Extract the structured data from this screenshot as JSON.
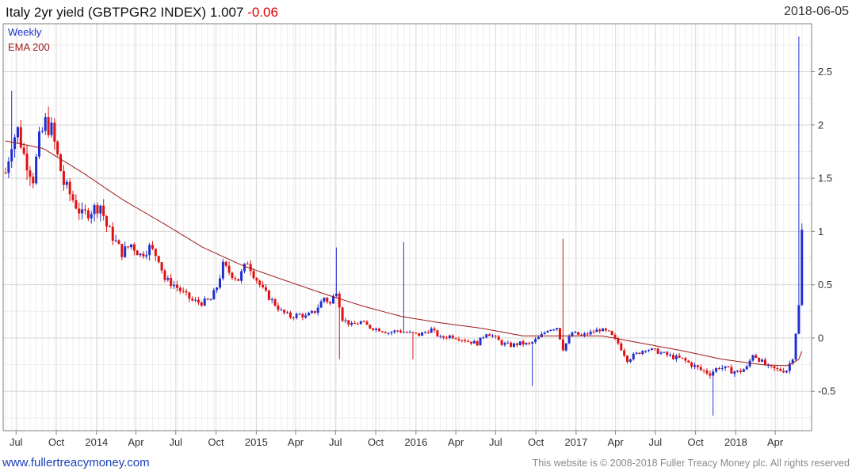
{
  "header": {
    "title": "Italy 2yr yield (GBTPGR2 INDEX) 1.007",
    "change": "-0.06",
    "date": "2018-06-05"
  },
  "legend": {
    "weekly": "Weekly",
    "ema": "EMA 200"
  },
  "footer": {
    "site": "www.fullertreacymoney.com",
    "copyright": "This website is © 2008-2018 Fuller Treacy Money plc. All rights reserved"
  },
  "colors": {
    "up": "#1f2fd0",
    "down": "#e01010",
    "ema": "#a01818",
    "grid": "#d9d9d9",
    "frame": "#7f7f7f"
  },
  "chart_data": {
    "type": "candlestick",
    "frequency": "weekly",
    "x_start": "2013-06-07",
    "x_end": "2018-06-05",
    "ylim": [
      -0.87,
      2.95
    ],
    "y_ticks": [
      -0.5,
      0,
      0.5,
      1,
      1.5,
      2,
      2.5
    ],
    "y_tick_labels": [
      "-0.5",
      "0",
      "0.5",
      "1",
      "1.5",
      "2",
      "2.5"
    ],
    "x_ticks": [
      {
        "date": "2013-07-01",
        "label": "Jul"
      },
      {
        "date": "2013-10-01",
        "label": "Oct"
      },
      {
        "date": "2014-01-01",
        "label": "2014"
      },
      {
        "date": "2014-04-01",
        "label": "Apr"
      },
      {
        "date": "2014-07-01",
        "label": "Jul"
      },
      {
        "date": "2014-10-01",
        "label": "Oct"
      },
      {
        "date": "2015-01-01",
        "label": "2015"
      },
      {
        "date": "2015-04-01",
        "label": "Apr"
      },
      {
        "date": "2015-07-01",
        "label": "Jul"
      },
      {
        "date": "2015-10-01",
        "label": "Oct"
      },
      {
        "date": "2016-01-01",
        "label": "2016"
      },
      {
        "date": "2016-04-01",
        "label": "Apr"
      },
      {
        "date": "2016-07-01",
        "label": "Jul"
      },
      {
        "date": "2016-10-01",
        "label": "Oct"
      },
      {
        "date": "2017-01-01",
        "label": "2017"
      },
      {
        "date": "2017-04-01",
        "label": "Apr"
      },
      {
        "date": "2017-07-01",
        "label": "Jul"
      },
      {
        "date": "2017-10-01",
        "label": "Oct"
      },
      {
        "date": "2018-01-01",
        "label": "2018"
      },
      {
        "date": "2018-04-01",
        "label": "Apr"
      }
    ],
    "price_anchors": [
      [
        "2013-06-07",
        1.55
      ],
      [
        "2013-06-21",
        1.85
      ],
      [
        "2013-07-05",
        1.95
      ],
      [
        "2013-07-19",
        1.72
      ],
      [
        "2013-08-09",
        1.5
      ],
      [
        "2013-08-23",
        1.85
      ],
      [
        "2013-09-06",
        2.02
      ],
      [
        "2013-09-20",
        1.95
      ],
      [
        "2013-10-04",
        1.7
      ],
      [
        "2013-10-18",
        1.45
      ],
      [
        "2013-11-08",
        1.3
      ],
      [
        "2013-11-29",
        1.15
      ],
      [
        "2013-12-20",
        1.2
      ],
      [
        "2014-01-10",
        1.25
      ],
      [
        "2014-01-24",
        1.05
      ],
      [
        "2014-02-07",
        0.95
      ],
      [
        "2014-02-28",
        0.8
      ],
      [
        "2014-03-21",
        0.88
      ],
      [
        "2014-04-11",
        0.78
      ],
      [
        "2014-05-02",
        0.85
      ],
      [
        "2014-05-23",
        0.75
      ],
      [
        "2014-06-06",
        0.55
      ],
      [
        "2014-06-27",
        0.5
      ],
      [
        "2014-07-18",
        0.42
      ],
      [
        "2014-08-08",
        0.35
      ],
      [
        "2014-08-29",
        0.33
      ],
      [
        "2014-09-19",
        0.36
      ],
      [
        "2014-10-03",
        0.48
      ],
      [
        "2014-10-17",
        0.68
      ],
      [
        "2014-10-31",
        0.62
      ],
      [
        "2014-11-21",
        0.55
      ],
      [
        "2014-12-12",
        0.72
      ],
      [
        "2014-12-26",
        0.6
      ],
      [
        "2015-01-16",
        0.45
      ],
      [
        "2015-02-06",
        0.35
      ],
      [
        "2015-02-27",
        0.25
      ],
      [
        "2015-03-20",
        0.2
      ],
      [
        "2015-04-10",
        0.22
      ],
      [
        "2015-04-24",
        0.2
      ],
      [
        "2015-05-15",
        0.25
      ],
      [
        "2015-06-05",
        0.38
      ],
      [
        "2015-06-19",
        0.32
      ],
      [
        "2015-07-03",
        0.45
      ],
      [
        "2015-07-17",
        0.18
      ],
      [
        "2015-08-07",
        0.12
      ],
      [
        "2015-08-28",
        0.15
      ],
      [
        "2015-09-18",
        0.1
      ],
      [
        "2015-10-09",
        0.08
      ],
      [
        "2015-10-30",
        0.05
      ],
      [
        "2015-11-20",
        0.07
      ],
      [
        "2015-12-11",
        0.05
      ],
      [
        "2016-01-08",
        0.03
      ],
      [
        "2016-02-05",
        0.08
      ],
      [
        "2016-02-26",
        0.0
      ],
      [
        "2016-03-18",
        0.02
      ],
      [
        "2016-04-08",
        0.0
      ],
      [
        "2016-04-29",
        -0.03
      ],
      [
        "2016-05-20",
        -0.05
      ],
      [
        "2016-06-10",
        0.05
      ],
      [
        "2016-06-24",
        0.02
      ],
      [
        "2016-07-15",
        -0.05
      ],
      [
        "2016-08-05",
        -0.07
      ],
      [
        "2016-08-26",
        -0.05
      ],
      [
        "2016-09-16",
        -0.06
      ],
      [
        "2016-10-07",
        0.0
      ],
      [
        "2016-10-28",
        0.08
      ],
      [
        "2016-11-18",
        0.1
      ],
      [
        "2016-12-02",
        -0.1
      ],
      [
        "2016-12-23",
        0.05
      ],
      [
        "2017-01-13",
        0.02
      ],
      [
        "2017-02-03",
        0.05
      ],
      [
        "2017-02-24",
        0.08
      ],
      [
        "2017-03-17",
        0.05
      ],
      [
        "2017-04-07",
        -0.05
      ],
      [
        "2017-04-28",
        -0.2
      ],
      [
        "2017-05-19",
        -0.15
      ],
      [
        "2017-06-09",
        -0.1
      ],
      [
        "2017-06-30",
        -0.12
      ],
      [
        "2017-07-21",
        -0.15
      ],
      [
        "2017-08-11",
        -0.18
      ],
      [
        "2017-09-01",
        -0.2
      ],
      [
        "2017-09-22",
        -0.25
      ],
      [
        "2017-10-13",
        -0.3
      ],
      [
        "2017-11-03",
        -0.33
      ],
      [
        "2017-11-24",
        -0.27
      ],
      [
        "2017-12-15",
        -0.3
      ],
      [
        "2018-01-05",
        -0.32
      ],
      [
        "2018-01-26",
        -0.28
      ],
      [
        "2018-02-09",
        -0.15
      ],
      [
        "2018-02-23",
        -0.2
      ],
      [
        "2018-03-16",
        -0.28
      ],
      [
        "2018-04-06",
        -0.3
      ],
      [
        "2018-04-27",
        -0.3
      ],
      [
        "2018-05-11",
        -0.18
      ],
      [
        "2018-05-18",
        0.05
      ],
      [
        "2018-05-25",
        0.3
      ],
      [
        "2018-06-01",
        1.0
      ],
      [
        "2018-06-05",
        1.007
      ]
    ],
    "wick_spikes": [
      [
        "2013-06-21",
        2.32
      ],
      [
        "2015-07-03",
        0.85
      ],
      [
        "2015-07-10",
        -0.2
      ],
      [
        "2015-12-04",
        0.9
      ],
      [
        "2015-12-25",
        -0.2
      ],
      [
        "2016-09-23",
        -0.45
      ],
      [
        "2016-12-02",
        0.93
      ],
      [
        "2017-11-10",
        -0.73
      ],
      [
        "2018-05-25",
        2.83
      ]
    ],
    "ema_anchors": [
      [
        "2013-06-07",
        1.85
      ],
      [
        "2013-09-01",
        1.78
      ],
      [
        "2013-12-01",
        1.55
      ],
      [
        "2014-03-01",
        1.3
      ],
      [
        "2014-06-01",
        1.08
      ],
      [
        "2014-09-01",
        0.85
      ],
      [
        "2014-12-01",
        0.68
      ],
      [
        "2015-03-01",
        0.55
      ],
      [
        "2015-06-01",
        0.42
      ],
      [
        "2015-09-01",
        0.3
      ],
      [
        "2015-12-01",
        0.2
      ],
      [
        "2016-03-01",
        0.14
      ],
      [
        "2016-06-01",
        0.09
      ],
      [
        "2016-09-01",
        0.02
      ],
      [
        "2016-12-01",
        0.02
      ],
      [
        "2017-03-01",
        0.02
      ],
      [
        "2017-06-01",
        -0.05
      ],
      [
        "2017-09-01",
        -0.12
      ],
      [
        "2017-12-01",
        -0.2
      ],
      [
        "2018-03-01",
        -0.25
      ],
      [
        "2018-05-01",
        -0.26
      ],
      [
        "2018-05-25",
        -0.2
      ],
      [
        "2018-06-05",
        -0.08
      ]
    ]
  }
}
